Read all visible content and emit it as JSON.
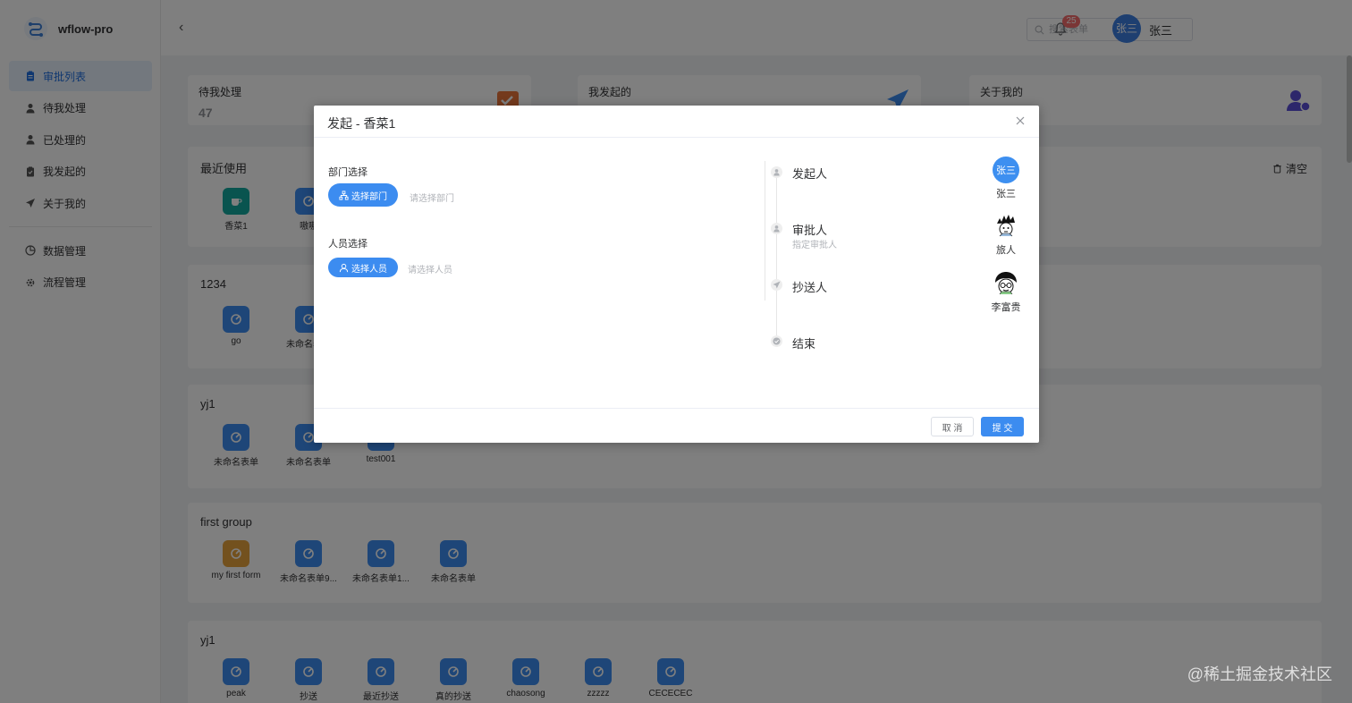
{
  "app": {
    "name": "wflow-pro"
  },
  "sidebar": {
    "items": [
      {
        "label": "审批列表",
        "icon": "clipboard-icon",
        "active": true
      },
      {
        "label": "待我处理",
        "icon": "user-icon"
      },
      {
        "label": "已处理的",
        "icon": "user-icon"
      },
      {
        "label": "我发起的",
        "icon": "clipboard-icon"
      },
      {
        "label": "关于我的",
        "icon": "paper-plane-icon"
      }
    ],
    "items2": [
      {
        "label": "数据管理",
        "icon": "pie-chart-icon"
      },
      {
        "label": "流程管理",
        "icon": "gear-icon"
      }
    ]
  },
  "topbar": {
    "search_placeholder": "搜索表单",
    "notification_count": "25",
    "avatar_text": "张三",
    "user_name": "张三"
  },
  "stats": [
    {
      "label": "待我处理",
      "value": "47",
      "icon": "inbox-icon",
      "color": "#e8743b"
    },
    {
      "label": "我发起的",
      "value": "",
      "icon": "paper-plane-icon",
      "color": "#3c8cf0"
    },
    {
      "label": "关于我的",
      "value": "",
      "icon": "user-bell-icon",
      "color": "#5b4fd6"
    }
  ],
  "groups": [
    {
      "title": "最近使用",
      "clear_label": "清空",
      "apps": [
        {
          "name": "香菜1",
          "color": "#13a89e",
          "icon": "cup-icon"
        },
        {
          "name": "嗷嗷",
          "color": "#3c8cf0",
          "icon": "form-icon"
        }
      ]
    },
    {
      "title": "1234",
      "apps": [
        {
          "name": "go",
          "color": "#3c8cf0",
          "icon": "form-icon"
        },
        {
          "name": "未命名表单",
          "color": "#3c8cf0",
          "icon": "form-icon"
        }
      ]
    },
    {
      "title": "yj1",
      "apps": [
        {
          "name": "未命名表单",
          "color": "#3c8cf0",
          "icon": "form-icon"
        },
        {
          "name": "未命名表单",
          "color": "#3c8cf0",
          "icon": "form-icon"
        },
        {
          "name": "test001",
          "color": "#3c8cf0",
          "icon": "form-icon"
        }
      ]
    },
    {
      "title": "first group",
      "apps": [
        {
          "name": "my first form",
          "color": "#e6a23c",
          "icon": "form-icon"
        },
        {
          "name": "未命名表单9...",
          "color": "#3c8cf0",
          "icon": "form-icon"
        },
        {
          "name": "未命名表单1...",
          "color": "#3c8cf0",
          "icon": "form-icon"
        },
        {
          "name": "未命名表单",
          "color": "#3c8cf0",
          "icon": "form-icon"
        }
      ]
    },
    {
      "title": "yj1",
      "apps": [
        {
          "name": "peak",
          "color": "#3c8cf0",
          "icon": "form-icon"
        },
        {
          "name": "抄送",
          "color": "#3c8cf0",
          "icon": "form-icon"
        },
        {
          "name": "最近抄送",
          "color": "#3c8cf0",
          "icon": "form-icon"
        },
        {
          "name": "真的抄送",
          "color": "#3c8cf0",
          "icon": "form-icon"
        },
        {
          "name": "chaosong",
          "color": "#3c8cf0",
          "icon": "form-icon"
        },
        {
          "name": "zzzzz",
          "color": "#3c8cf0",
          "icon": "form-icon"
        },
        {
          "name": "CECECEC",
          "color": "#3c8cf0",
          "icon": "form-icon"
        }
      ]
    }
  ],
  "dialog": {
    "title": "发起 - 香菜1",
    "dept_label": "部门选择",
    "dept_button": "选择部门",
    "dept_hint": "请选择部门",
    "user_label": "人员选择",
    "user_button": "选择人员",
    "user_hint": "请选择人员",
    "timeline": [
      {
        "title": "发起人",
        "sub": "",
        "icon": "user-icon",
        "user": "张三",
        "avatar": "text",
        "avatar_text": "张三"
      },
      {
        "title": "审批人",
        "sub": "指定审批人",
        "icon": "user-icon",
        "user": "旅人",
        "avatar": "cartoon-boy-avatar"
      },
      {
        "title": "抄送人",
        "sub": "",
        "icon": "paper-plane-icon",
        "user": "李富贵",
        "avatar": "cartoon-glasses-avatar"
      },
      {
        "title": "结束",
        "sub": "",
        "icon": "check-circle-icon",
        "user": ""
      }
    ],
    "cancel_label": "取 消",
    "submit_label": "提 交"
  },
  "watermark": "@稀土掘金技术社区"
}
